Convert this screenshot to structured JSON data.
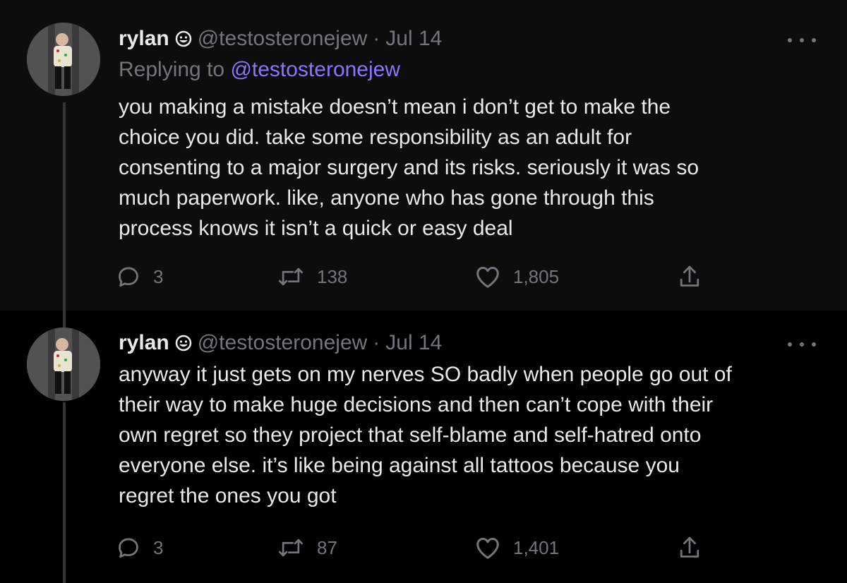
{
  "tweets": [
    {
      "author_name": "rylan",
      "handle": "@testosteronejew",
      "separator": "·",
      "date": "Jul 14",
      "replying_prefix": "Replying to",
      "replying_to": "@testosteronejew",
      "text_lines": [
        "you making a mistake doesn’t mean i don’t get to make the",
        "choice you did. take some responsibility as an adult for",
        "consenting to a major surgery and its risks. seriously it was so",
        "much paperwork. like, anyone  who has gone through this",
        "process knows it isn’t a quick or easy deal"
      ],
      "replies": "3",
      "retweets": "138",
      "likes": "1,805"
    },
    {
      "author_name": "rylan",
      "handle": "@testosteronejew",
      "separator": "·",
      "date": "Jul 14",
      "text_lines": [
        "anyway it just gets on my nerves SO badly when people go out of",
        "their way to make huge decisions and then can’t cope with their",
        "own regret so they project that self-blame and self-hatred onto",
        "everyone else. it’s like being against all tattoos because you",
        "regret the ones you got"
      ],
      "replies": "3",
      "retweets": "87",
      "likes": "1,401"
    }
  ],
  "icons": {
    "verified": "smiley-badge-icon",
    "more": "more-horizontal-icon",
    "reply": "reply-icon",
    "retweet": "retweet-icon",
    "like": "heart-icon",
    "share": "share-icon"
  },
  "colors": {
    "background": "#000000",
    "highlight_background": "#0d0d0d",
    "text": "#e7e9ea",
    "secondary_text": "#71767b",
    "mention": "#8b74ff"
  }
}
